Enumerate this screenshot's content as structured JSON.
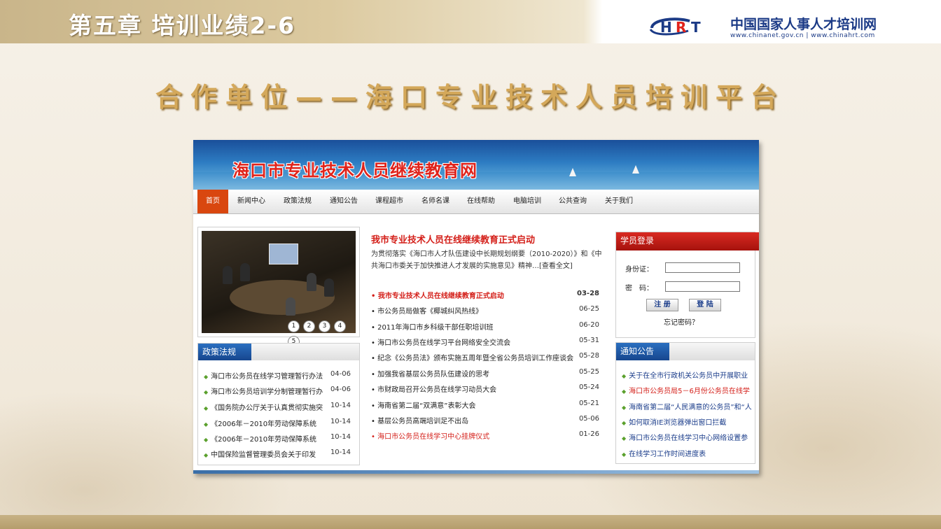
{
  "slide": {
    "chapter_title": "第五章  培训业绩2-6",
    "logo_text": "中国国家人事人才培训网",
    "logo_url": "www.chinanet.gov.cn | www.chinahrt.com",
    "heading": "合作单位——海口专业技术人员培训平台"
  },
  "site": {
    "banner_title": "海口市专业技术人员继续教育网",
    "nav": [
      "首页",
      "新闻中心",
      "政策法规",
      "通知公告",
      "课程超市",
      "名师名课",
      "在线帮助",
      "电脑培训",
      "公共查询",
      "关于我们"
    ],
    "slideshow_pages": [
      "1",
      "2",
      "3",
      "4",
      "5"
    ],
    "headline": "我市专业技术人员在线继续教育正式启动",
    "summary": "为贯彻落实《海口市人才队伍建设中长期规划纲要（2010-2020）》和《中共海口市委关于加快推进人才发展的实施意见》精神…[查看全文]",
    "news": [
      {
        "title": "我市专业技术人员在线继续教育正式启动",
        "date": "03-28",
        "style": "redbold"
      },
      {
        "title": "市公务员局做客《椰城纠风热线》",
        "date": "06-25",
        "style": ""
      },
      {
        "title": "2011年海口市乡科级干部任职培训班",
        "date": "06-20",
        "style": ""
      },
      {
        "title": "海口市公务员在线学习平台网络安全交流会",
        "date": "05-31",
        "style": ""
      },
      {
        "title": "纪念《公务员法》颁布实施五周年暨全省公务员培训工作座谈会",
        "date": "05-28",
        "style": ""
      },
      {
        "title": "加强我省基层公务员队伍建设的思考",
        "date": "05-25",
        "style": ""
      },
      {
        "title": "市财政局召开公务员在线学习动员大会",
        "date": "05-24",
        "style": ""
      },
      {
        "title": "海南省第二届“双满意”表彰大会",
        "date": "05-21",
        "style": ""
      },
      {
        "title": "基层公务员高端培训足不出岛",
        "date": "05-06",
        "style": ""
      },
      {
        "title": "海口市公务员在线学习中心挂牌仪式",
        "date": "01-26",
        "style": "red"
      }
    ],
    "policy": {
      "title": "政策法规",
      "items": [
        {
          "title": "海口市公务员在线学习管理暂行办法",
          "date": "04-06"
        },
        {
          "title": "海口市公务员培训学分制管理暂行办",
          "date": "04-06"
        },
        {
          "title": "《国务院办公厅关于认真贯彻实施突",
          "date": "10-14"
        },
        {
          "title": "《2006年－2010年劳动保障系统",
          "date": "10-14"
        },
        {
          "title": "《2006年－2010年劳动保障系统",
          "date": "10-14"
        },
        {
          "title": "中国保险监督管理委员会关于印发",
          "date": "10-14"
        }
      ]
    },
    "login": {
      "title": "学员登录",
      "id_label": "身份证：",
      "pwd_label": "密　码：",
      "register": "注 册",
      "login": "登 陆",
      "forgot": "忘记密码？"
    },
    "notice": {
      "title": "通知公告",
      "items": [
        {
          "title": "关于在全市行政机关公务员中开展职业",
          "style": ""
        },
        {
          "title": "海口市公务员局5－6月份公务员在线学",
          "style": "red"
        },
        {
          "title": "海南省第二届“人民满意的公务员”和“人",
          "style": ""
        },
        {
          "title": "如何取消IE浏览器弹出窗口拦截",
          "style": ""
        },
        {
          "title": "海口市公务员在线学习中心网络设置参",
          "style": ""
        },
        {
          "title": "在线学习工作时间进度表",
          "style": ""
        }
      ]
    }
  }
}
